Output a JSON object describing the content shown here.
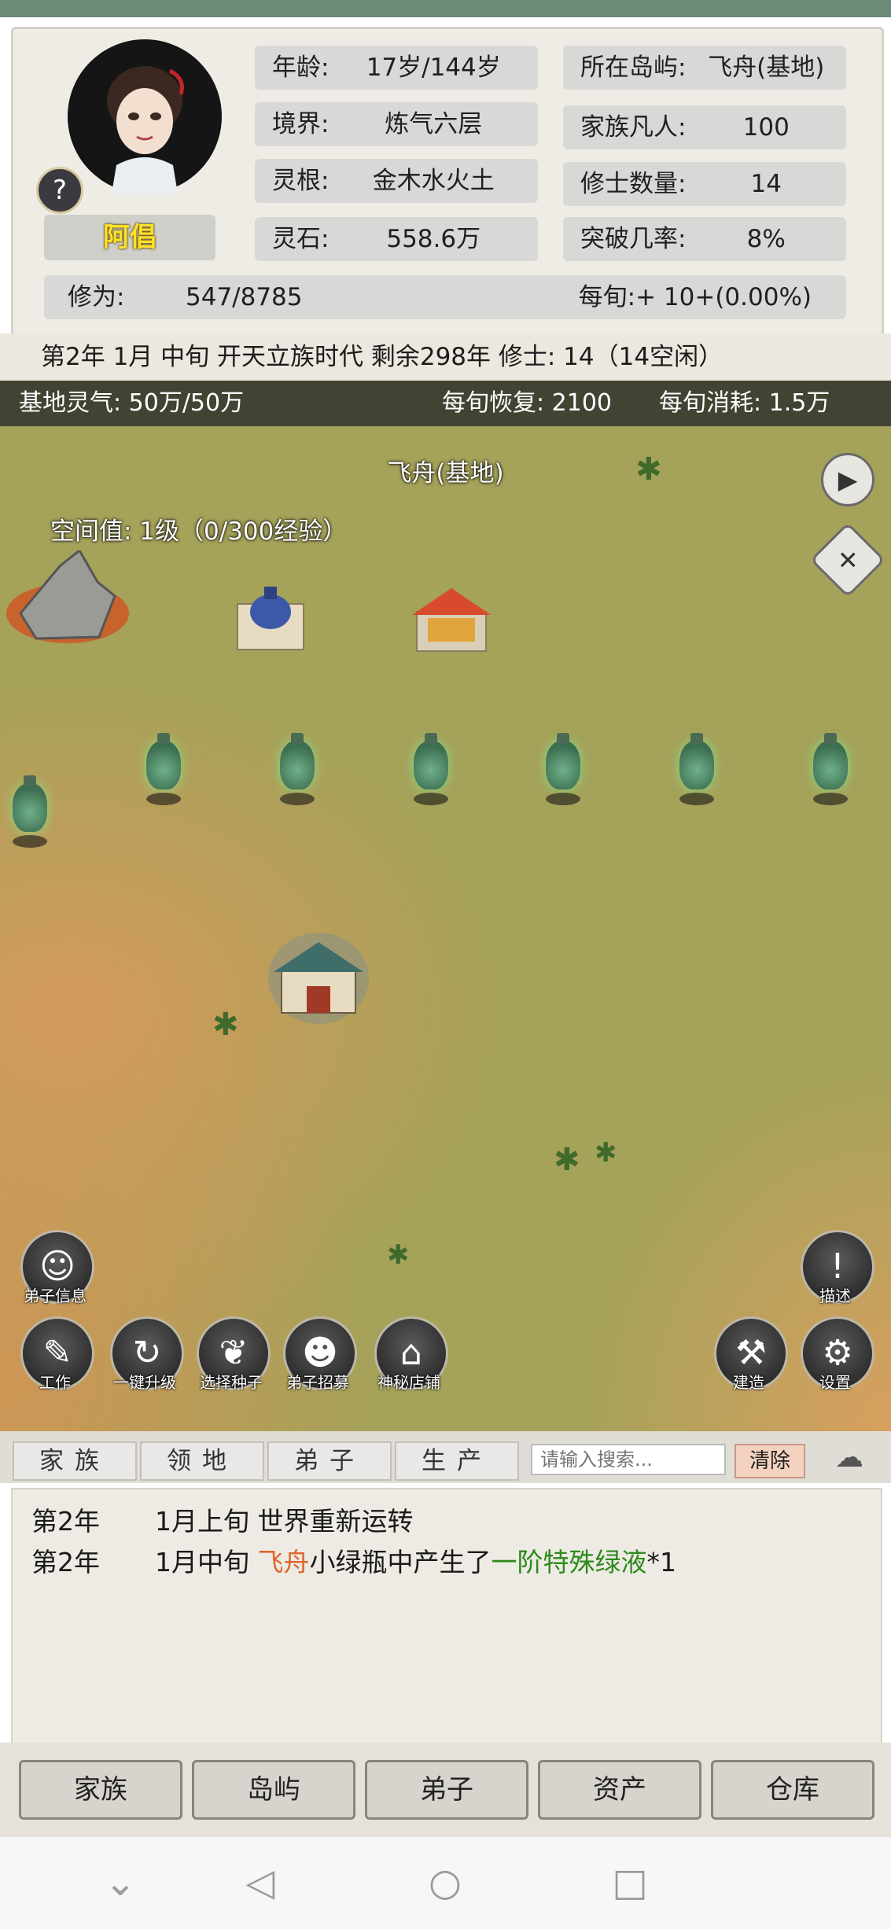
{
  "header": {
    "avatar_icon": "character-portrait-icon",
    "help_icon_glyph": "?",
    "name": "阿倡",
    "stats_left": [
      {
        "label": "年龄:",
        "value": "17岁/144岁"
      },
      {
        "label": "境界:",
        "value": "炼气六层"
      },
      {
        "label": "灵根:",
        "value": "金木水火土"
      },
      {
        "label": "灵石:",
        "value": "558.6万"
      }
    ],
    "stats_right": [
      {
        "label": "所在岛屿:",
        "value": "飞舟(基地)"
      },
      {
        "label": "家族凡人:",
        "value": "100"
      },
      {
        "label": "修士数量:",
        "value": "14"
      },
      {
        "label": "突破几率:",
        "value": "8%"
      }
    ],
    "cultivation_label": "修为:",
    "cultivation_value": "547/8785",
    "per_turn_label": "每旬:",
    "per_turn_value": "+ 10+(0.00%)"
  },
  "status_line": "第2年 1月 中旬  开天立族时代 剩余298年  修士: 14（14空闲）",
  "map": {
    "base_qi": "基地灵气: 50万/50万",
    "recover": "每旬恢复: 2100",
    "consume": "每旬消耗: 1.5万",
    "location_title": "飞舟(基地)",
    "space_value": "空间值: 1级（0/300经验）",
    "bottle_icon": "green-bottle-icon",
    "buttons_left": [
      {
        "label": "弟子信息",
        "icon": "disciple-info-icon"
      },
      {
        "label": "工作",
        "icon": "work-icon"
      },
      {
        "label": "一键升级",
        "icon": "upgrade-icon"
      },
      {
        "label": "选择种子",
        "icon": "seed-icon"
      },
      {
        "label": "弟子招募",
        "icon": "recruit-icon"
      },
      {
        "label": "神秘店铺",
        "icon": "shop-icon"
      }
    ],
    "buttons_right": [
      {
        "label": "描述",
        "icon": "description-icon"
      },
      {
        "label": "建造",
        "icon": "build-hammer-icon"
      },
      {
        "label": "设置",
        "icon": "settings-gear-icon"
      }
    ],
    "play_icon": "play-icon",
    "close_icon": "close-icon"
  },
  "tabs": [
    "家族",
    "领地",
    "弟子",
    "生产"
  ],
  "search": {
    "placeholder": "请输入搜索..."
  },
  "clear_label": "清除",
  "log": [
    {
      "year": "第2年",
      "time": "1月上旬",
      "parts": [
        {
          "text": " 世界重新运转",
          "color": "#1a1a1a"
        }
      ]
    },
    {
      "year": "第2年",
      "time": "1月中旬",
      "parts": [
        {
          "text": " 飞舟",
          "color": "#e0652c"
        },
        {
          "text": "小绿瓶中产生了",
          "color": "#1a1a1a"
        },
        {
          "text": "一阶特殊绿液",
          "color": "#2c8a1c"
        },
        {
          "text": "*1",
          "color": "#1a1a1a"
        }
      ]
    }
  ],
  "nav": [
    "家族",
    "岛屿",
    "弟子",
    "资产",
    "仓库"
  ],
  "system_nav": [
    "chevron-down-icon",
    "back-icon",
    "home-icon",
    "recents-icon"
  ]
}
